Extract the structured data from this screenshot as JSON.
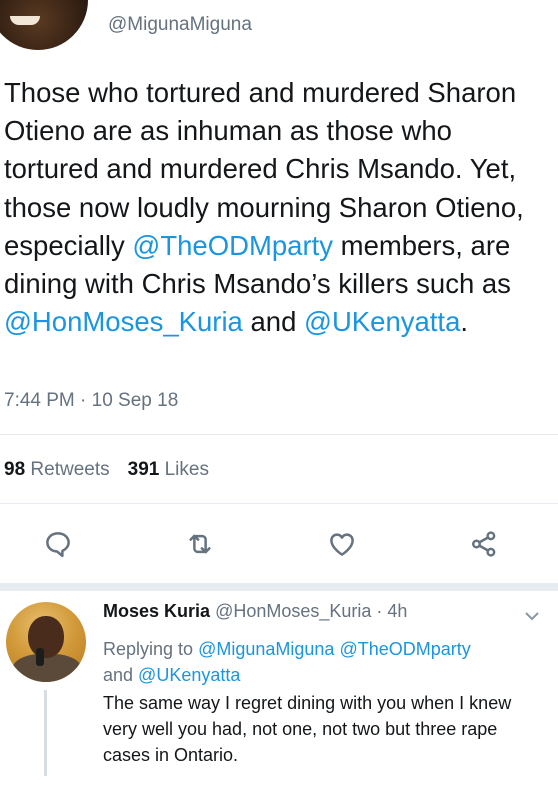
{
  "main_tweet": {
    "handle": "@MigunaMiguna",
    "text": {
      "part1": "Those who tortured and murdered Sharon Otieno are as inhuman as those who tortured and murdered Chris Msando. Yet, those now loudly mourning Sharon Otieno, especially ",
      "mention1": "@TheODMparty",
      "part2": " members, are dining with Chris Msando’s killers such as ",
      "mention2": "@HonMoses_Kuria",
      "part3": " and ",
      "mention3": "@UKenyatta",
      "part4": "."
    },
    "timestamp": "7:44 PM · 10 Sep 18",
    "retweets_count": "98",
    "retweets_label": "Retweets",
    "likes_count": "391",
    "likes_label": "Likes"
  },
  "actions": {
    "icons": [
      "reply-icon",
      "retweet-icon",
      "like-icon",
      "share-icon"
    ]
  },
  "reply_tweet": {
    "name": "Moses Kuria",
    "handle": "@HonMoses_Kuria",
    "time": "· 4h",
    "replying_prefix": "Replying to ",
    "replying_mention1": "@MigunaMiguna",
    "replying_mention2": "@TheODMparty",
    "replying_and": "and ",
    "replying_mention3": "@UKenyatta",
    "text": "The same way I regret dining with you when I knew very well you had, not one, not two but three rape cases in Ontario."
  },
  "colors": {
    "link": "#1b95e0",
    "secondary_text": "#65727f",
    "primary_text": "#14171a",
    "divider": "#e6ecf0"
  }
}
